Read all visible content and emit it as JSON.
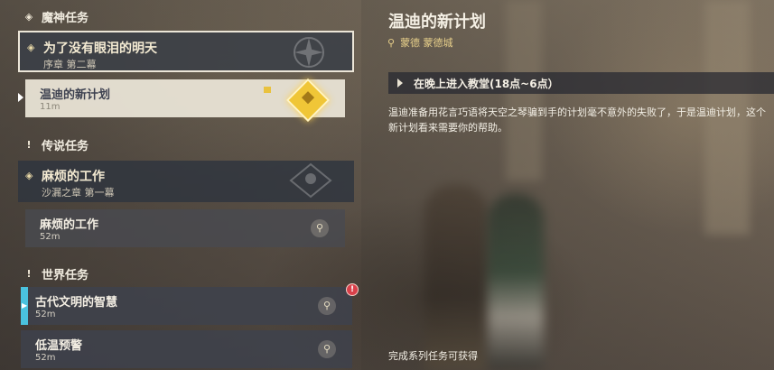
{
  "categories": {
    "archon": {
      "label": "魔神任务"
    },
    "story": {
      "label": "传说任务"
    },
    "world": {
      "label": "世界任务"
    }
  },
  "archon_chapter": {
    "title": "为了没有眼泪的明天",
    "subtitle": "序章 第二幕"
  },
  "archon_quest": {
    "title": "温迪的新计划",
    "distance": "11m"
  },
  "story_chapter": {
    "title": "麻烦的工作",
    "subtitle": "沙漏之章 第一幕"
  },
  "story_quest": {
    "title": "麻烦的工作",
    "distance": "52m"
  },
  "world_quests": [
    {
      "title": "古代文明的智慧",
      "distance": "52m",
      "alert": "!"
    },
    {
      "title": "低温预警",
      "distance": "52m"
    }
  ],
  "detail": {
    "title": "温迪的新计划",
    "location": "蒙德 蒙德城",
    "objective": "在晚上进入教堂(18点~6点）",
    "description": "温迪准备用花言巧语将天空之琴骗到手的计划毫不意外的失败了，于是温迪计划，这个新计划看来需要你的帮助。",
    "rewards_label": "完成系列任务可获得"
  },
  "colors": {
    "selected_border": "#ece6d8",
    "track_gold": "#f0c637",
    "world_quest_accent": "#4ac2de",
    "alert_red": "#d8404a",
    "location_gold": "#e7cf8a"
  },
  "icons": {
    "archon_category": "diamond-outline-icon",
    "legend_category": "exclamation-icon",
    "world_category": "exclamation-icon",
    "location": "map-pin-icon",
    "objective": "play-triangle-icon",
    "navigate": "location-pin-icon",
    "tracking": "gold-diamond-tracking-icon"
  }
}
